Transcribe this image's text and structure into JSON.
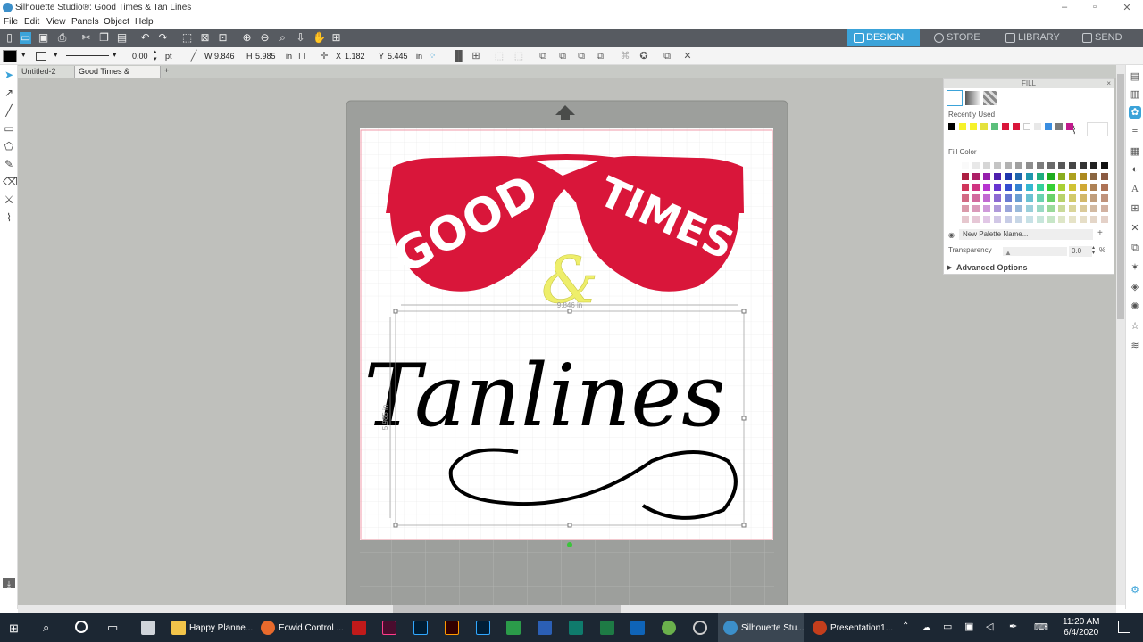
{
  "window": {
    "title": "Silhouette Studio®: Good Times & Tan Lines"
  },
  "menu": [
    "File",
    "Edit",
    "View",
    "Panels",
    "Object",
    "Help"
  ],
  "nav_tabs": [
    {
      "label": "DESIGN",
      "active": true
    },
    {
      "label": "STORE",
      "active": false
    },
    {
      "label": "LIBRARY",
      "active": false
    },
    {
      "label": "SEND",
      "active": false
    }
  ],
  "toolbar2": {
    "line_width": "0.00",
    "line_unit": "pt",
    "w_label": "W",
    "w_value": "9.846",
    "h_label": "H",
    "h_value": "5.985",
    "size_unit": "in",
    "x_label": "X",
    "x_value": "1.182",
    "y_label": "Y",
    "y_value": "5.445",
    "pos_unit": "in"
  },
  "doc_tabs": [
    {
      "label": "Untitled-2",
      "active": false
    },
    {
      "label": "Good Times & Ta...",
      "active": true
    }
  ],
  "design": {
    "word1": "GOOD",
    "word2": "TIMES",
    "ampersand": "&",
    "script": "Tanlines",
    "width_readout": "9.846 in",
    "height_readout": "5.985 in",
    "glasses_color": "#d9163a",
    "ampersand_color": "#eeee6a"
  },
  "fill_panel": {
    "title": "FILL",
    "recently_used_label": "Recently Used",
    "recently_used": [
      "#000000",
      "#f6f22a",
      "#f6f22a",
      "#e4e23d",
      "#5bbf7b",
      "#d9163a",
      "#d9163a",
      "#ffffff",
      "#e8e8e8",
      "#3a8de0",
      "#7a7a7a",
      "#c21a8c"
    ],
    "fill_color_label": "Fill Color",
    "palette_name_placeholder": "New Palette Name...",
    "transparency_label": "Transparency",
    "transparency_value": "0.0",
    "transparency_unit": "%",
    "advanced_label": "Advanced Options"
  },
  "taskbar": {
    "items": [
      {
        "label": "Happy Planne..."
      },
      {
        "label": "Ecwid Control ..."
      },
      {
        "label": "Silhouette Stu..."
      },
      {
        "label": "Presentation1..."
      }
    ],
    "time": "11:20 AM",
    "date": "6/4/2020"
  }
}
